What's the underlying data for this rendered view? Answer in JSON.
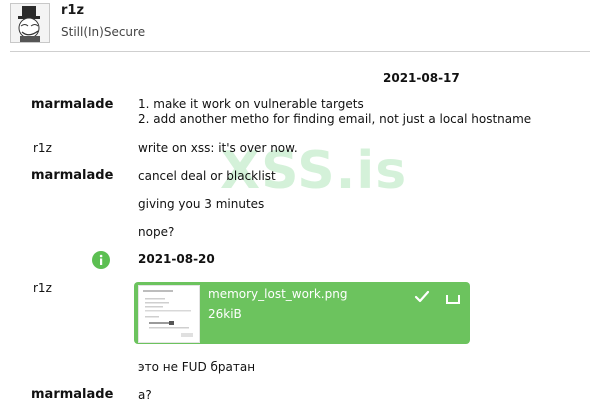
{
  "contact": {
    "name": "r1z",
    "status": "Still(In)Secure"
  },
  "watermark": "XSS.is",
  "dates": [
    "2021-08-17",
    "2021-08-20"
  ],
  "messages": [
    {
      "sender": "marmalade",
      "lines": [
        "1. make it work on vulnerable targets",
        "2. add another metho for finding email, not just a local hostname"
      ]
    },
    {
      "sender": "r1z",
      "text": "write on xss: it's over now."
    },
    {
      "sender": "marmalade",
      "text": "cancel deal or blacklist"
    },
    {
      "text": "giving you 3 minutes"
    },
    {
      "text": "nope?"
    },
    {
      "text": "это не FUD братан"
    },
    {
      "sender": "marmalade",
      "text": "a?"
    }
  ],
  "attachment": {
    "sender": "r1z",
    "filename": "memory_lost_work.png",
    "size": "26kiB"
  },
  "colors": {
    "accent": "#6cc35e",
    "watermark": "#3dbe50"
  },
  "icons": [
    "info-icon",
    "check-icon",
    "download-icon",
    "avatar"
  ]
}
